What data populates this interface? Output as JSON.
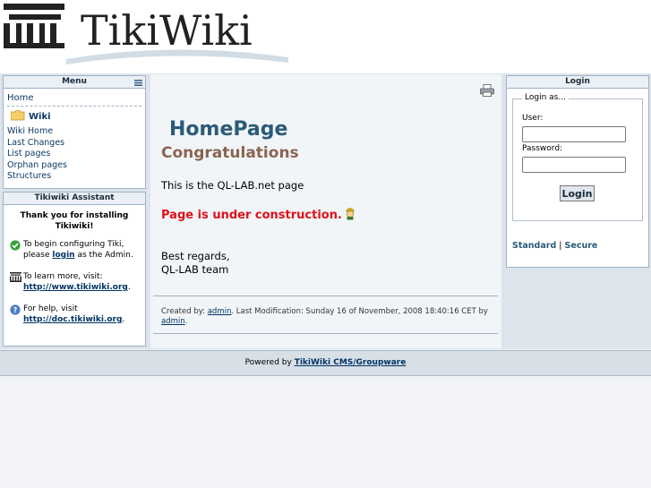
{
  "header": {
    "logo_text": "TikiWiki"
  },
  "menu": {
    "title": "Menu",
    "items": [
      "Home",
      "Wiki",
      "Wiki Home",
      "Last Changes",
      "List pages",
      "Orphan pages",
      "Structures"
    ]
  },
  "assistant": {
    "title": "Tikiwiki Assistant",
    "thanks": "Thank you for installing Tikiwiki!",
    "configure_pre": "To begin configuring Tiki, please",
    "configure_link": "login",
    "configure_post": "as the Admin.",
    "learn_pre": "To learn more, visit:",
    "learn_link": "http://www.tikiwiki.org",
    "help_pre": "For help, visit",
    "help_link": "http://doc.tikiwiki.org"
  },
  "content": {
    "page_title": "HomePage",
    "heading": "Congratulations",
    "intro": "This is the QL-LAB.net page",
    "construction": "Page is under construction.",
    "regards1": "Best regards,",
    "regards2": "QL-LAB team",
    "created_by_label": "Created by:",
    "created_by_user": "admin",
    "modified_text": ". Last Modification: Sunday 16 of November, 2008 18:40:16 CET",
    "by_label": "by",
    "modified_user": "admin"
  },
  "login": {
    "title": "Login",
    "legend": "Login as...",
    "user_label": "User:",
    "password_label": "Password:",
    "button": "Login",
    "standard": "Standard",
    "separator": "|",
    "secure": "Secure"
  },
  "footer": {
    "powered_by": "Powered by",
    "link": "TikiWiki CMS/Groupware"
  },
  "colors": {
    "title_blue": "#2b5a78",
    "heading_brown": "#8a6450",
    "warning_red": "#e0101a"
  }
}
